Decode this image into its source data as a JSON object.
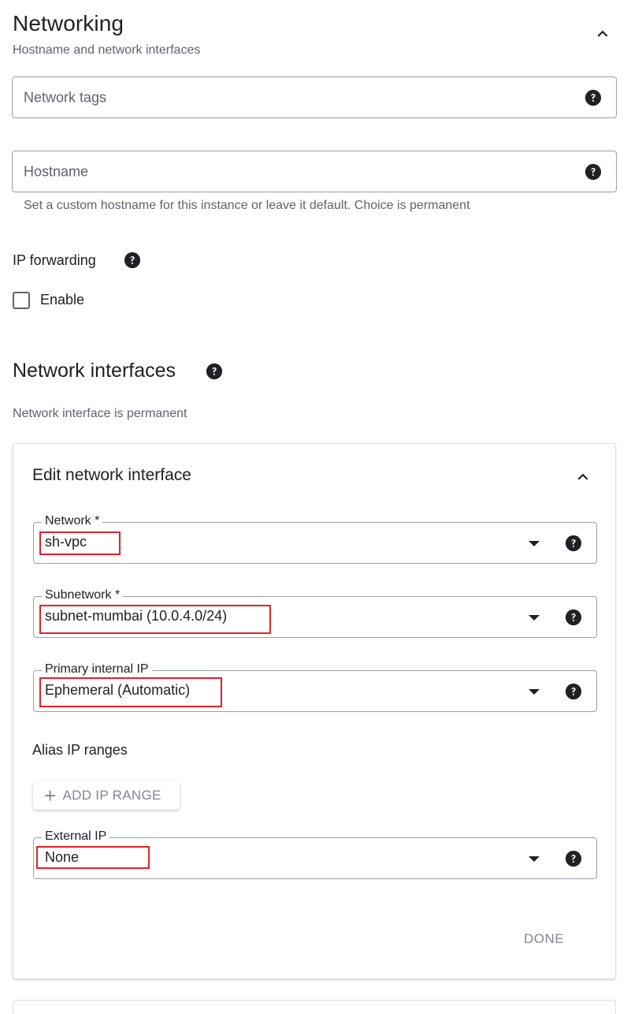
{
  "networking": {
    "title": "Networking",
    "subtitle": "Hostname and network interfaces"
  },
  "network_tags": {
    "placeholder": "Network tags"
  },
  "hostname": {
    "placeholder": "Hostname",
    "hint": "Set a custom hostname for this instance or leave it default. Choice is permanent"
  },
  "ip_forwarding": {
    "label": "IP forwarding",
    "checkbox_label": "Enable",
    "checked": false
  },
  "network_interfaces": {
    "title": "Network interfaces",
    "hint": "Network interface is permanent"
  },
  "edit_interface": {
    "title": "Edit network interface",
    "network": {
      "label": "Network *",
      "value": "sh-vpc"
    },
    "subnetwork": {
      "label": "Subnetwork *",
      "value": "subnet-mumbai (10.0.4.0/24)"
    },
    "primary_internal_ip": {
      "label": "Primary internal IP",
      "value": "Ephemeral (Automatic)"
    },
    "alias_ip_ranges": {
      "label": "Alias IP ranges",
      "add_button": "ADD IP RANGE"
    },
    "external_ip": {
      "label": "External IP",
      "value": "None"
    },
    "done_button": "DONE"
  },
  "colors": {
    "highlight": "#e5202a",
    "border": "#9aa0a6",
    "muted_text": "#5f6368"
  },
  "icons": {
    "collapse": "chevron-up-icon",
    "help": "help-icon",
    "dropdown": "caret-down-icon",
    "add": "plus-icon"
  }
}
